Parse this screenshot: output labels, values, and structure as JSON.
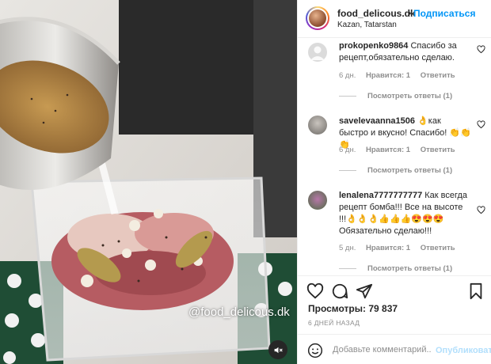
{
  "media": {
    "watermark": "@food_delicous.dk",
    "mute_icon": "speaker-muted-icon"
  },
  "header": {
    "username": "food_delicous.dk",
    "separator": "•",
    "follow_label": "Подписаться",
    "location": "Kazan, Tatarstan"
  },
  "comments": [
    {
      "username": "prokopenko9864",
      "text": "Спасибо за рецепт,обязательно сделаю.",
      "age": "6 дн.",
      "likes": "Нравится: 1",
      "reply_label": "Ответить",
      "view_replies": "Посмотреть ответы (1)"
    },
    {
      "username": "savelevaanna1506",
      "text": "👌как быстро и вкусно! Спасибо! 👏👏👏",
      "age": "6 дн.",
      "likes": "Нравится: 1",
      "reply_label": "Ответить",
      "view_replies": "Посмотреть ответы (1)"
    },
    {
      "username": "lenalena7777777777",
      "text": "Как всегда рецепт бомба!!! Все на высоте !!!👌👌👌👍👍👍😍😍😍 Обязательно сделаю!!!",
      "age": "5 дн.",
      "likes": "Нравится: 1",
      "reply_label": "Ответить",
      "view_replies": "Посмотреть ответы (1)"
    }
  ],
  "actions": {
    "icons": [
      "heart-icon",
      "comment-icon",
      "share-icon",
      "bookmark-icon"
    ]
  },
  "stats": {
    "views_label": "Просмотры:",
    "views_value": "79 837",
    "date": "6 ДНЕЙ НАЗАД"
  },
  "add_comment": {
    "placeholder": "Добавьте комментарий...",
    "publish_label": "Опубликовать"
  },
  "colors": {
    "accent": "#0095f6",
    "publish_disabled": "#b2dffc",
    "muted_text": "#8e8e8e"
  }
}
